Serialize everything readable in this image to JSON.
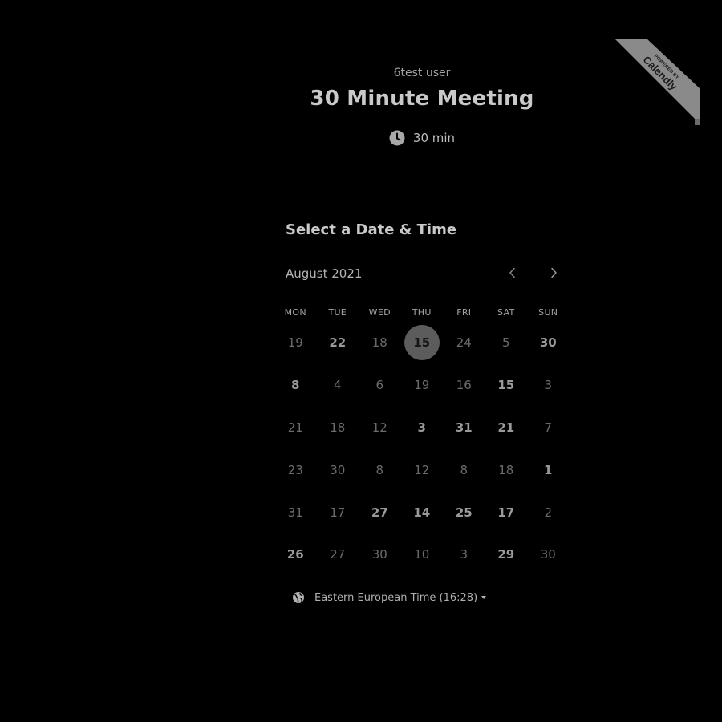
{
  "header": {
    "owner_name": "6test user",
    "event_title": "30 Minute Meeting",
    "duration": "30 min",
    "duration_icon": "clock-icon"
  },
  "ribbon": {
    "line1": "POWERED BY",
    "line2": "Calendly"
  },
  "calendar": {
    "heading": "Select a Date & Time",
    "month_label": "August 2021",
    "prev_icon": "chevron-left-icon",
    "next_icon": "chevron-right-icon",
    "weekdays": [
      "MON",
      "TUE",
      "WED",
      "THU",
      "FRI",
      "SAT",
      "SUN"
    ],
    "days": [
      {
        "label": "19",
        "available": false
      },
      {
        "label": "22",
        "available": true
      },
      {
        "label": "18",
        "available": false
      },
      {
        "label": "15",
        "available": true,
        "selected": true
      },
      {
        "label": "24",
        "available": false
      },
      {
        "label": "5",
        "available": false
      },
      {
        "label": "30",
        "available": true
      },
      {
        "label": "8",
        "available": true
      },
      {
        "label": "4",
        "available": false
      },
      {
        "label": "6",
        "available": false
      },
      {
        "label": "19",
        "available": false
      },
      {
        "label": "16",
        "available": false
      },
      {
        "label": "15",
        "available": true
      },
      {
        "label": "3",
        "available": false
      },
      {
        "label": "21",
        "available": false
      },
      {
        "label": "18",
        "available": false
      },
      {
        "label": "12",
        "available": false
      },
      {
        "label": "3",
        "available": true
      },
      {
        "label": "31",
        "available": true
      },
      {
        "label": "21",
        "available": true
      },
      {
        "label": "7",
        "available": false
      },
      {
        "label": "23",
        "available": false
      },
      {
        "label": "30",
        "available": false
      },
      {
        "label": "8",
        "available": false
      },
      {
        "label": "12",
        "available": false
      },
      {
        "label": "8",
        "available": false
      },
      {
        "label": "18",
        "available": false
      },
      {
        "label": "1",
        "available": true
      },
      {
        "label": "31",
        "available": false
      },
      {
        "label": "17",
        "available": false
      },
      {
        "label": "27",
        "available": true
      },
      {
        "label": "14",
        "available": true
      },
      {
        "label": "25",
        "available": true
      },
      {
        "label": "17",
        "available": true
      },
      {
        "label": "2",
        "available": false
      },
      {
        "label": "26",
        "available": true
      },
      {
        "label": "27",
        "available": false
      },
      {
        "label": "30",
        "available": false
      },
      {
        "label": "10",
        "available": false
      },
      {
        "label": "3",
        "available": false
      },
      {
        "label": "29",
        "available": true
      },
      {
        "label": "30",
        "available": false
      }
    ]
  },
  "timezone": {
    "label": "Eastern European Time (16:28)",
    "icon": "globe-icon"
  },
  "colors": {
    "background": "#000000",
    "selected_day_bg": "#5c5c5c",
    "ribbon_bg": "#8a8a8a"
  }
}
